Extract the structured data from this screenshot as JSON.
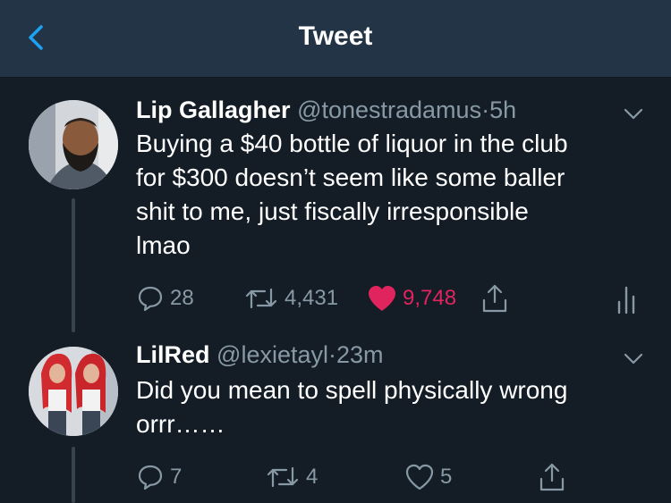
{
  "header": {
    "title": "Tweet"
  },
  "tweets": [
    {
      "name": "Lip Gallagher",
      "handle": "@tonestradamus",
      "time": "5h",
      "separator": "·",
      "text": "Buying a $40 bottle of liquor in the club\nfor $300 doesn’t seem like some baller\nshit to me, just fiscally irresponsible\nlmao",
      "replies": "28",
      "retweets": "4,431",
      "likes": "9,748",
      "liked": true
    },
    {
      "name": "LilRed",
      "handle": "@lexietayl",
      "time": "23m",
      "separator": "·",
      "text": "Did you mean to spell physically wrong\norrr……",
      "replies": "7",
      "retweets": "4",
      "likes": "5",
      "liked": false
    }
  ],
  "icons": {
    "back": "chevron-left-icon",
    "caret": "chevron-down-icon",
    "reply": "reply-icon",
    "retweet": "retweet-icon",
    "like": "heart-icon",
    "share": "share-icon",
    "analytics": "analytics-icon"
  },
  "colors": {
    "background": "#141d26",
    "header": "#243447",
    "accent": "#1da1f2",
    "muted": "#8899a6",
    "like": "#e0245e",
    "thread_line": "#38444d"
  }
}
